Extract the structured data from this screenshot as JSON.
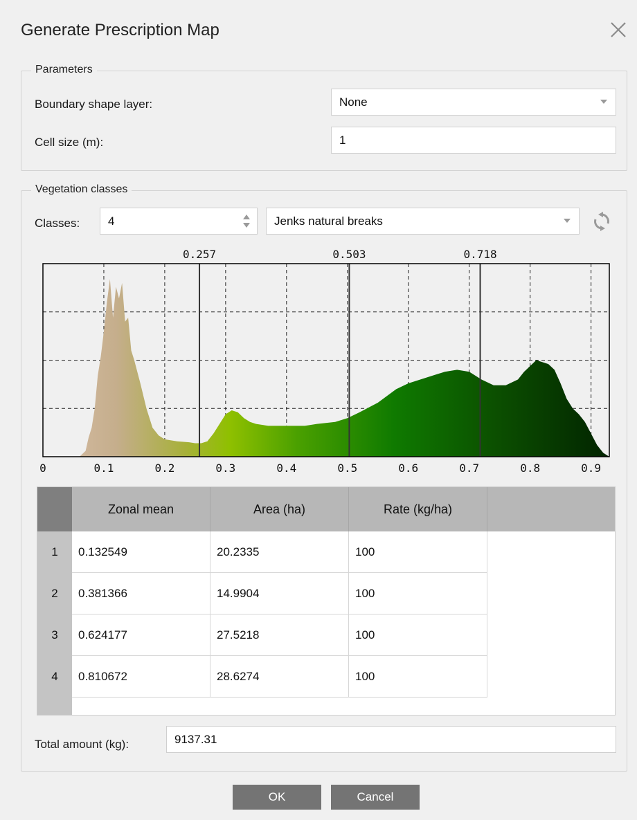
{
  "dialog": {
    "title": "Generate Prescription Map"
  },
  "parameters": {
    "group_title": "Parameters",
    "boundary_label": "Boundary shape layer:",
    "boundary_value": "None",
    "cell_size_label": "Cell size (m):",
    "cell_size_value": "1"
  },
  "vegetation": {
    "group_title": "Vegetation classes",
    "classes_label": "Classes:",
    "classes_value": "4",
    "method_value": "Jenks natural breaks"
  },
  "chart_data": {
    "type": "area",
    "x_range": [
      0,
      0.93
    ],
    "xticks": [
      "0",
      "0.1",
      "0.2",
      "0.3",
      "0.4",
      "0.5",
      "0.6",
      "0.7",
      "0.8",
      "0.9"
    ],
    "breaks": [
      {
        "value": 0.257,
        "label": "0.257"
      },
      {
        "value": 0.503,
        "label": "0.503"
      },
      {
        "value": 0.718,
        "label": "0.718"
      }
    ],
    "grid": true,
    "x": [
      0.06,
      0.07,
      0.075,
      0.08,
      0.085,
      0.09,
      0.095,
      0.1,
      0.105,
      0.11,
      0.115,
      0.12,
      0.125,
      0.13,
      0.135,
      0.14,
      0.145,
      0.15,
      0.16,
      0.17,
      0.18,
      0.19,
      0.2,
      0.22,
      0.24,
      0.25,
      0.26,
      0.27,
      0.28,
      0.29,
      0.3,
      0.31,
      0.32,
      0.33,
      0.34,
      0.35,
      0.37,
      0.4,
      0.43,
      0.45,
      0.48,
      0.5,
      0.52,
      0.55,
      0.58,
      0.6,
      0.62,
      0.64,
      0.66,
      0.68,
      0.7,
      0.72,
      0.74,
      0.76,
      0.78,
      0.79,
      0.8,
      0.81,
      0.82,
      0.83,
      0.84,
      0.85,
      0.86,
      0.87,
      0.88,
      0.89,
      0.9,
      0.91,
      0.92,
      0.93
    ],
    "y": [
      0,
      0.03,
      0.1,
      0.15,
      0.25,
      0.42,
      0.52,
      0.65,
      0.8,
      0.92,
      0.72,
      0.88,
      0.82,
      0.9,
      0.7,
      0.72,
      0.55,
      0.5,
      0.38,
      0.25,
      0.15,
      0.11,
      0.09,
      0.08,
      0.075,
      0.07,
      0.07,
      0.08,
      0.12,
      0.17,
      0.22,
      0.24,
      0.23,
      0.2,
      0.18,
      0.17,
      0.16,
      0.16,
      0.16,
      0.17,
      0.18,
      0.2,
      0.23,
      0.28,
      0.35,
      0.38,
      0.4,
      0.42,
      0.44,
      0.45,
      0.44,
      0.4,
      0.37,
      0.37,
      0.4,
      0.44,
      0.47,
      0.5,
      0.49,
      0.48,
      0.45,
      0.38,
      0.3,
      0.25,
      0.22,
      0.18,
      0.12,
      0.06,
      0.02,
      0
    ]
  },
  "table": {
    "headers": [
      "Zonal mean",
      "Area (ha)",
      "Rate (kg/ha)"
    ],
    "rows": [
      {
        "index": "1",
        "mean": "0.132549",
        "area": "20.2335",
        "rate": "100"
      },
      {
        "index": "2",
        "mean": "0.381366",
        "area": "14.9904",
        "rate": "100"
      },
      {
        "index": "3",
        "mean": "0.624177",
        "area": "27.5218",
        "rate": "100"
      },
      {
        "index": "4",
        "mean": "0.810672",
        "area": "28.6274",
        "rate": "100"
      }
    ]
  },
  "total": {
    "label": "Total amount (kg):",
    "value": "9137.31"
  },
  "buttons": {
    "ok": "OK",
    "cancel": "Cancel"
  },
  "icons": {
    "close": "close-icon",
    "refresh": "refresh-icon",
    "combo": "chevron-down-icon",
    "spin": "spin-arrows-icon"
  }
}
